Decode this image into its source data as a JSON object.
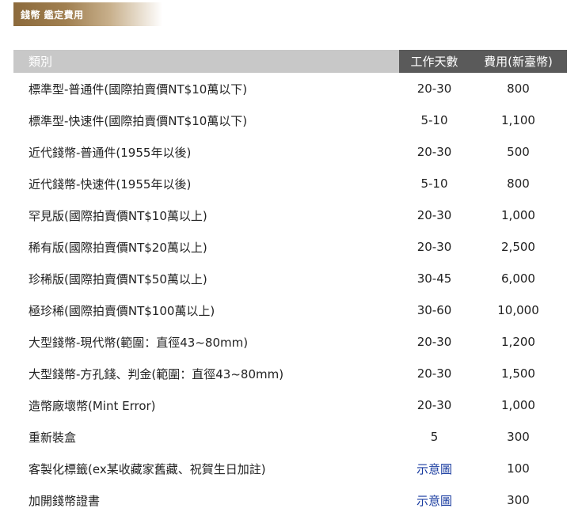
{
  "header": {
    "title": "錢幣 鑑定費用",
    "accent_color": "#8c6a3c"
  },
  "table": {
    "columns": {
      "category": "類別",
      "days": "工作天數",
      "fee": "費用(新臺幣)"
    },
    "rows": [
      {
        "category": "標準型-普通件(國際拍賣價NT$10萬以下)",
        "days": "20-30",
        "fee": "800"
      },
      {
        "category": "標準型-快速件(國際拍賣價NT$10萬以下)",
        "days": "5-10",
        "fee": "1,100"
      },
      {
        "category": "近代錢幣-普通件(1955年以後)",
        "days": "20-30",
        "fee": "500"
      },
      {
        "category": "近代錢幣-快速件(1955年以後)",
        "days": "5-10",
        "fee": "800"
      },
      {
        "category": "罕見版(國際拍賣價NT$10萬以上)",
        "days": "20-30",
        "fee": "1,000"
      },
      {
        "category": "稀有版(國際拍賣價NT$20萬以上)",
        "days": "20-30",
        "fee": "2,500"
      },
      {
        "category": "珍稀版(國際拍賣價NT$50萬以上)",
        "days": "30-45",
        "fee": "6,000"
      },
      {
        "category": "極珍稀(國際拍賣價NT$100萬以上)",
        "days": "30-60",
        "fee": "10,000"
      },
      {
        "category": "大型錢幣-現代幣(範圍：直徑43~80mm)",
        "days": "20-30",
        "fee": "1,200"
      },
      {
        "category": "大型錢幣-方孔錢、判金(範圍：直徑43~80mm)",
        "days": "20-30",
        "fee": "1,500"
      },
      {
        "category": "造幣廠壞幣(Mint Error)",
        "days": "20-30",
        "fee": "1,000"
      },
      {
        "category": "重新裝盒",
        "days": "5",
        "fee": "300"
      },
      {
        "category": "客製化標籤(ex某收藏家舊藏、祝賀生日加註)",
        "days": "示意圖",
        "days_is_link": true,
        "fee": "100"
      },
      {
        "category": "加開錢幣證書",
        "days": "示意圖",
        "days_is_link": true,
        "fee": "300"
      }
    ]
  }
}
